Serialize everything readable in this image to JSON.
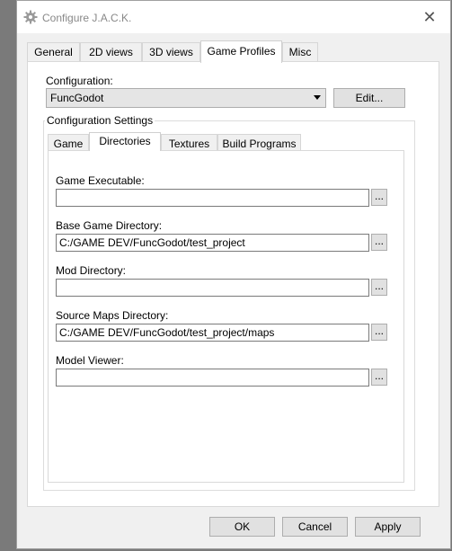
{
  "window": {
    "title": "Configure J.A.C.K.",
    "close_glyph": "✕",
    "title_icon": "gear-icon"
  },
  "main_tabs": [
    {
      "label": "General"
    },
    {
      "label": "2D views"
    },
    {
      "label": "3D views"
    },
    {
      "label": "Game Profiles"
    },
    {
      "label": "Misc"
    }
  ],
  "active_main_tab": "Game Profiles",
  "configuration": {
    "label": "Configuration:",
    "value": "FuncGodot",
    "edit_label": "Edit..."
  },
  "settings": {
    "group_title": "Configuration Settings",
    "tabs": [
      {
        "label": "Game"
      },
      {
        "label": "Directories"
      },
      {
        "label": "Textures"
      },
      {
        "label": "Build Programs"
      }
    ],
    "active_tab": "Directories",
    "browse_label": "...",
    "fields": [
      {
        "label": "Game Executable:",
        "value": ""
      },
      {
        "label": "Base Game Directory:",
        "value": "C:/GAME DEV/FuncGodot/test_project"
      },
      {
        "label": "Mod Directory:",
        "value": ""
      },
      {
        "label": "Source Maps Directory:",
        "value": "C:/GAME DEV/FuncGodot/test_project/maps"
      },
      {
        "label": "Model Viewer:",
        "value": ""
      }
    ]
  },
  "footer": {
    "ok_label": "OK",
    "cancel_label": "Cancel",
    "apply_label": "Apply"
  }
}
